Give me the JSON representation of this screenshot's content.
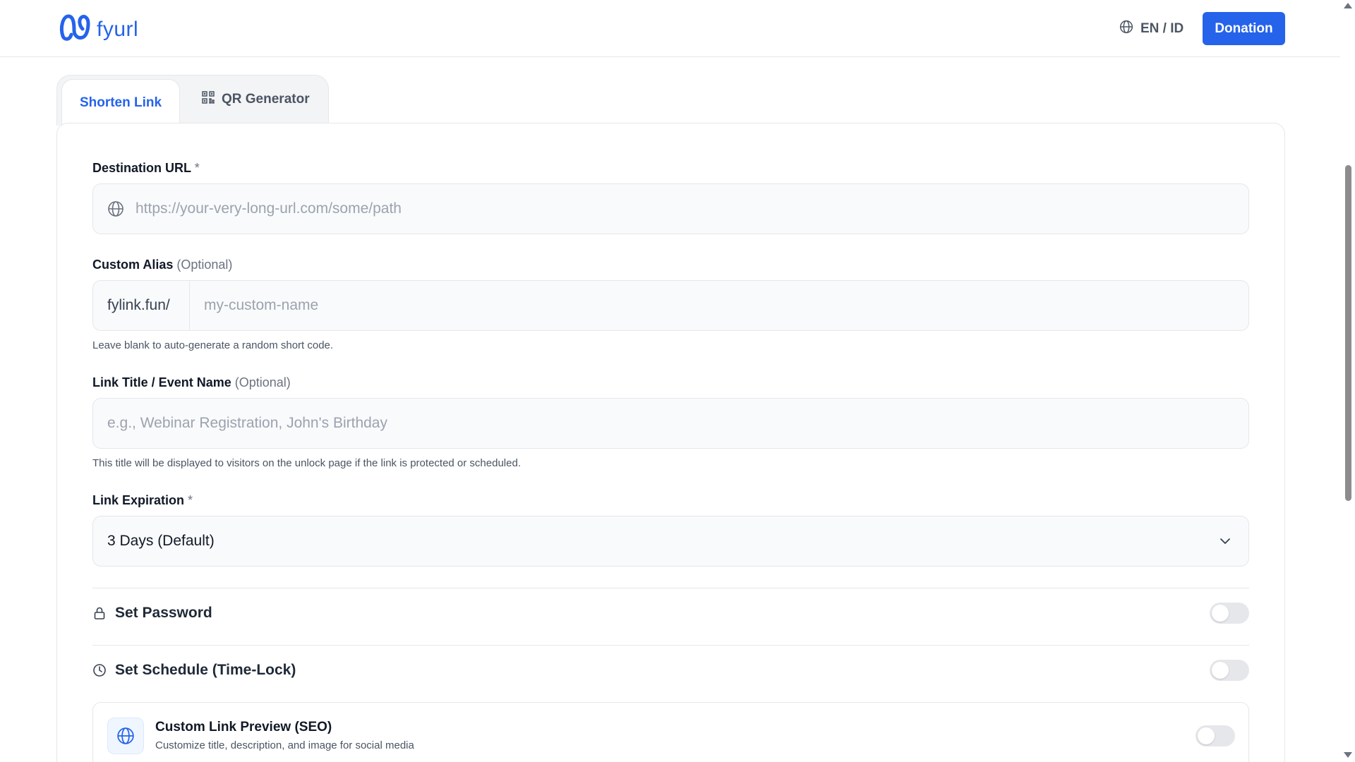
{
  "header": {
    "logo_text": "fyurl",
    "lang_label": "EN / ID",
    "donation_label": "Donation"
  },
  "tabs": [
    {
      "label": "Shorten Link",
      "active": true
    },
    {
      "label": "QR Generator",
      "active": false
    }
  ],
  "form": {
    "destination": {
      "label": "Destination URL",
      "required_mark": "*",
      "placeholder": "https://your-very-long-url.com/some/path",
      "icon": "globe-icon"
    },
    "alias": {
      "label": "Custom Alias",
      "optional": "(Optional)",
      "prefix": "fylink.fun/",
      "placeholder": "my-custom-name",
      "hint": "Leave blank to auto-generate a random short code."
    },
    "title": {
      "label": "Link Title / Event Name",
      "optional": "(Optional)",
      "placeholder": "e.g., Webinar Registration, John's Birthday",
      "hint": "This title will be displayed to visitors on the unlock page if the link is protected or scheduled."
    },
    "expiration": {
      "label": "Link Expiration",
      "required_mark": "*",
      "value": "3 Days (Default)"
    },
    "password": {
      "label": "Set Password",
      "icon": "lock-icon",
      "enabled": false
    },
    "schedule": {
      "label": "Set Schedule (Time-Lock)",
      "icon": "clock-icon",
      "enabled": false
    },
    "seo": {
      "title": "Custom Link Preview (SEO)",
      "description": "Customize title, description, and image for social media",
      "icon": "globe-icon",
      "enabled": false
    }
  },
  "colors": {
    "accent": "#2563eb",
    "border": "#e5e7eb",
    "input_bg": "#f9fafb"
  }
}
